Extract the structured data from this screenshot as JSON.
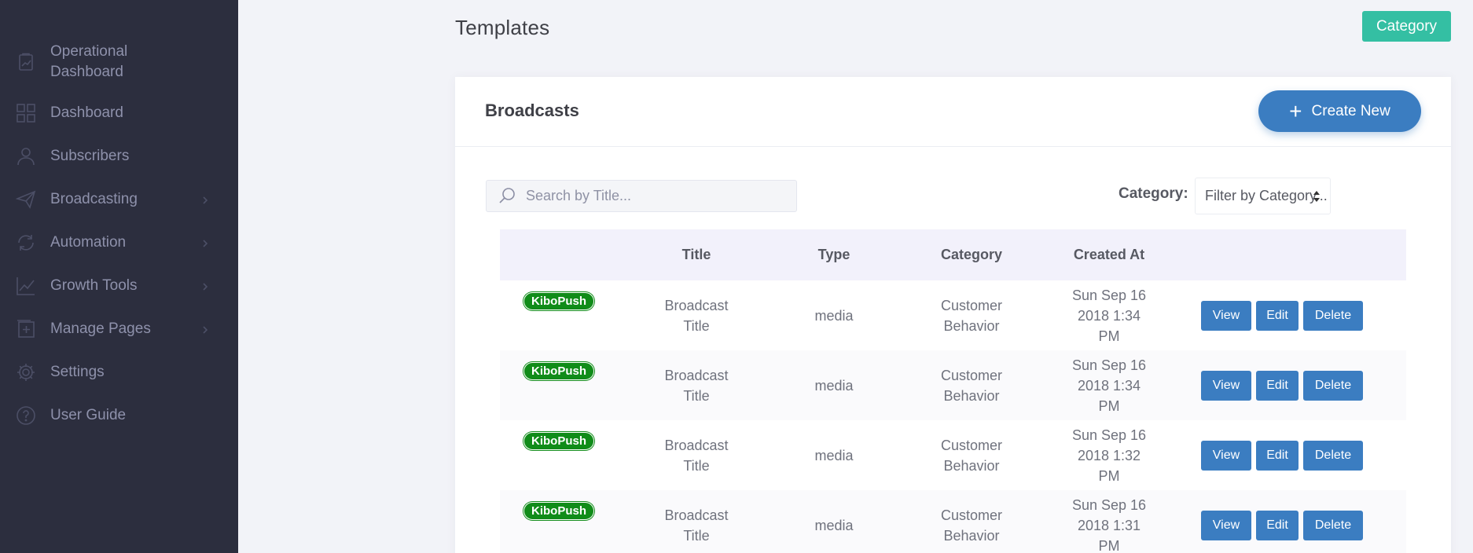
{
  "sidebar": {
    "items": [
      {
        "label": "Operational Dashboard",
        "icon": "clipboard-chart-icon",
        "submenu": false
      },
      {
        "label": "Dashboard",
        "icon": "grid-icon",
        "submenu": false
      },
      {
        "label": "Subscribers",
        "icon": "user-icon",
        "submenu": false
      },
      {
        "label": "Broadcasting",
        "icon": "paper-plane-icon",
        "submenu": true
      },
      {
        "label": "Automation",
        "icon": "refresh-icon",
        "submenu": true
      },
      {
        "label": "Growth Tools",
        "icon": "line-chart-icon",
        "submenu": true
      },
      {
        "label": "Manage Pages",
        "icon": "add-page-icon",
        "submenu": true
      },
      {
        "label": "Settings",
        "icon": "gear-icon",
        "submenu": false
      },
      {
        "label": "User Guide",
        "icon": "question-icon",
        "submenu": false
      }
    ]
  },
  "header": {
    "title": "Templates",
    "category_button": "Category"
  },
  "portlet": {
    "title": "Broadcasts",
    "create_button": "Create New",
    "search_placeholder": "Search by Title...",
    "filter_label": "Category:",
    "filter_value": "Filter by Category..."
  },
  "table": {
    "columns": [
      "",
      "Title",
      "Type",
      "Category",
      "Created At",
      ""
    ],
    "rows": [
      {
        "badge": "KiboPush",
        "title": "Broadcast Title",
        "type": "media",
        "category": "Customer Behavior",
        "created_at": "Sun Sep 16 2018 1:34 PM"
      },
      {
        "badge": "KiboPush",
        "title": "Broadcast Title",
        "type": "media",
        "category": "Customer Behavior",
        "created_at": "Sun Sep 16 2018 1:34 PM"
      },
      {
        "badge": "KiboPush",
        "title": "Broadcast Title",
        "type": "media",
        "category": "Customer Behavior",
        "created_at": "Sun Sep 16 2018 1:32 PM"
      },
      {
        "badge": "KiboPush",
        "title": "Broadcast Title",
        "type": "media",
        "category": "Customer Behavior",
        "created_at": "Sun Sep 16 2018 1:31 PM"
      }
    ],
    "actions": {
      "view": "View",
      "edit": "Edit",
      "delete": "Delete"
    }
  },
  "colors": {
    "sidebar_bg": "#2c2e3e",
    "accent_teal": "#34bfa3",
    "primary_blue": "#3b7dc1",
    "badge_green": "#108c19"
  }
}
